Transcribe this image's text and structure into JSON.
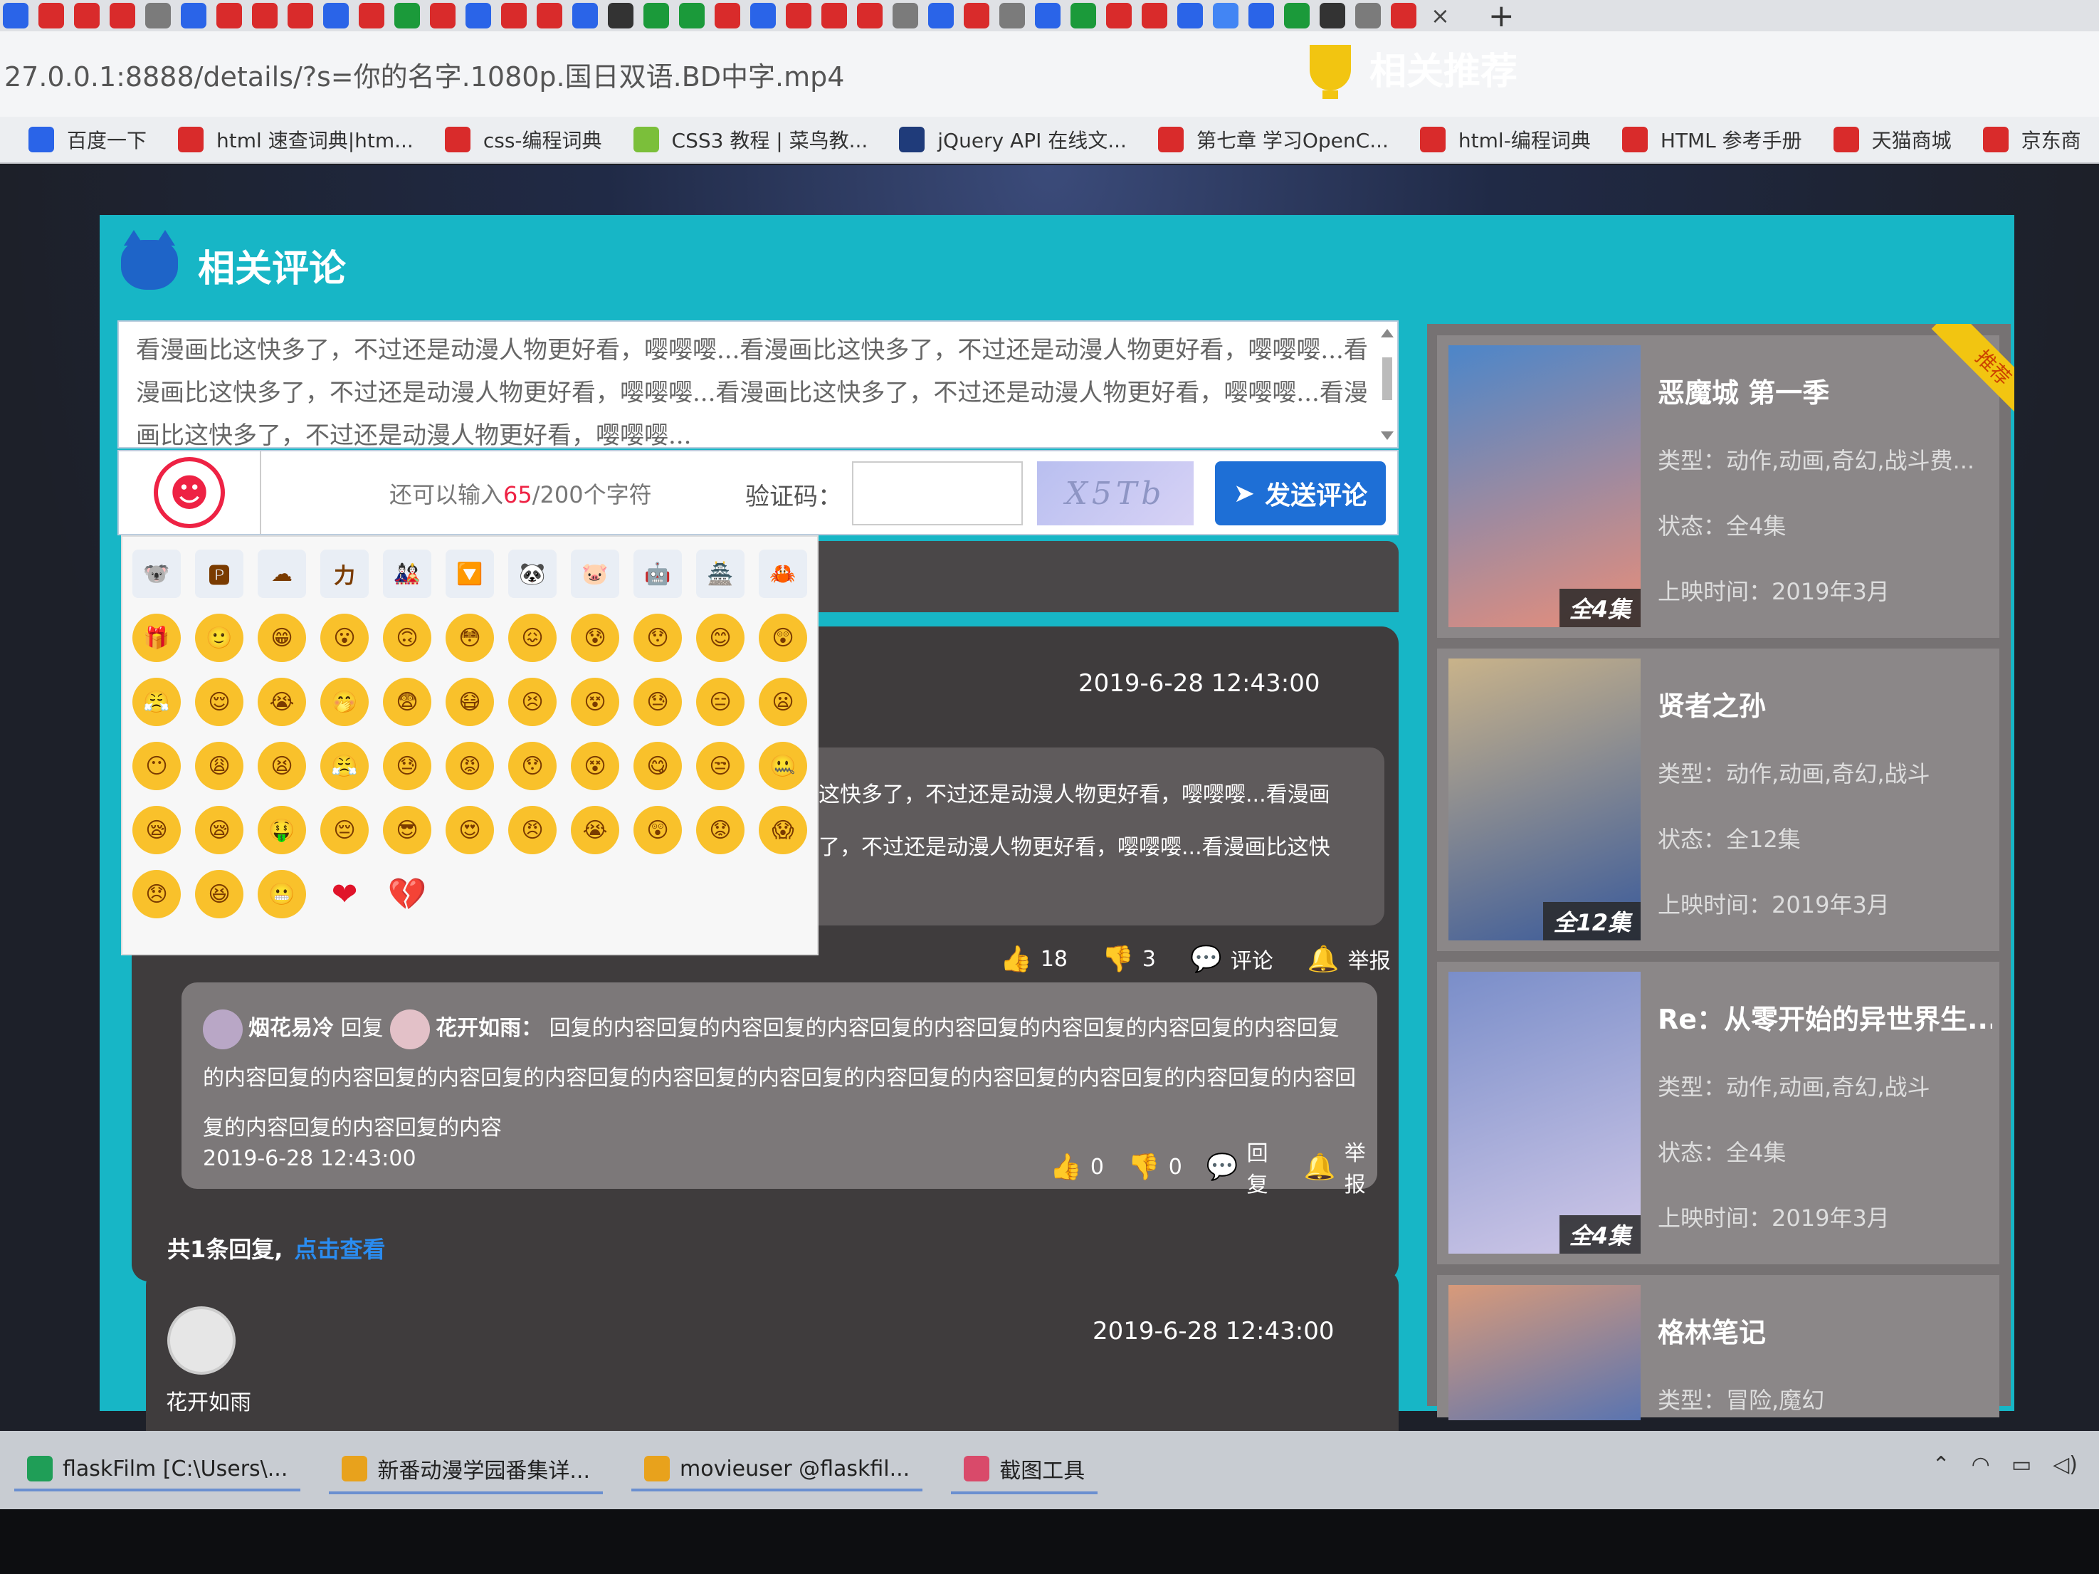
{
  "browser": {
    "tab_icons": [
      {
        "icon": "baidu-paw",
        "color": "#2a64e8"
      },
      {
        "icon": "c-logo",
        "color": "#d92b2b"
      },
      {
        "icon": "c-logo",
        "color": "#d92b2b"
      },
      {
        "icon": "c-logo",
        "color": "#d92b2b"
      },
      {
        "icon": "runoob",
        "color": "#7b7b7b"
      },
      {
        "icon": "baidu-paw",
        "color": "#2a64e8"
      },
      {
        "icon": "c-logo",
        "color": "#d92b2b"
      },
      {
        "icon": "c-logo",
        "color": "#d92b2b"
      },
      {
        "icon": "c-logo",
        "color": "#d92b2b"
      },
      {
        "icon": "baidu-paw",
        "color": "#2a64e8"
      },
      {
        "icon": "c-logo",
        "color": "#d92b2b"
      },
      {
        "icon": "green-c",
        "color": "#1b9a3a"
      },
      {
        "icon": "c-logo",
        "color": "#d92b2b"
      },
      {
        "icon": "baidu-paw",
        "color": "#2a64e8"
      },
      {
        "icon": "c-logo",
        "color": "#d92b2b"
      },
      {
        "icon": "c-logo",
        "color": "#d92b2b"
      },
      {
        "icon": "baidu-paw",
        "color": "#2a64e8"
      },
      {
        "icon": "github",
        "color": "#333333"
      },
      {
        "icon": "green-c",
        "color": "#1b9a3a"
      },
      {
        "icon": "sf",
        "color": "#1b9a3a"
      },
      {
        "icon": "c-logo",
        "color": "#d92b2b"
      },
      {
        "icon": "baidu-paw",
        "color": "#2a64e8"
      },
      {
        "icon": "c-logo",
        "color": "#d92b2b"
      },
      {
        "icon": "c-logo",
        "color": "#d92b2b"
      },
      {
        "icon": "c-logo",
        "color": "#d92b2b"
      },
      {
        "icon": "runoob",
        "color": "#7b7b7b"
      },
      {
        "icon": "baidu-paw",
        "color": "#2a64e8"
      },
      {
        "icon": "c-logo",
        "color": "#d92b2b"
      },
      {
        "icon": "runoob",
        "color": "#7b7b7b"
      },
      {
        "icon": "baidu-paw",
        "color": "#2a64e8"
      },
      {
        "icon": "green-leaf",
        "color": "#1b9a3a"
      },
      {
        "icon": "c-logo",
        "color": "#d92b2b"
      },
      {
        "icon": "c-logo",
        "color": "#d92b2b"
      },
      {
        "icon": "baidu-paw",
        "color": "#2a64e8"
      },
      {
        "icon": "google",
        "color": "#4285f4"
      },
      {
        "icon": "baidu-paw",
        "color": "#2a64e8"
      },
      {
        "icon": "a-logo",
        "color": "#1b9a3a"
      },
      {
        "icon": "github",
        "color": "#333333"
      },
      {
        "icon": "runoob",
        "color": "#7b7b7b"
      },
      {
        "icon": "d-logo",
        "color": "#d92b2b"
      }
    ],
    "tab_close": "×",
    "new_tab": "+",
    "url": "27.0.0.1:8888/details/?s=你的名字.1080p.国日双语.BD中字.mp4"
  },
  "bookmarks": [
    {
      "icon": "baidu-paw-icon",
      "color": "#2a64e8",
      "label": "百度一下"
    },
    {
      "icon": "html-icon",
      "color": "#d92b2b",
      "label": "html 速查词典|htm..."
    },
    {
      "icon": "php-icon",
      "color": "#d92b2b",
      "label": "css-编程词典"
    },
    {
      "icon": "runoob-icon",
      "color": "#7bbf3a",
      "label": "CSS3 教程 | 菜鸟教..."
    },
    {
      "icon": "jquery-icon",
      "color": "#1f3b7a",
      "label": "jQuery API 在线文..."
    },
    {
      "icon": "csdn-icon",
      "color": "#d92b2b",
      "label": "第七章 学习OpenC..."
    },
    {
      "icon": "php-icon",
      "color": "#d92b2b",
      "label": "html-编程词典"
    },
    {
      "icon": "w3-icon",
      "color": "#d92b2b",
      "label": "HTML 参考手册"
    },
    {
      "icon": "tmall-icon",
      "color": "#d92b2b",
      "label": "天猫商城"
    },
    {
      "icon": "jd-icon",
      "color": "#d92b2b",
      "label": "京东商"
    }
  ],
  "comments_section": {
    "title": "相关评论",
    "textarea_text": "看漫画比这快多了，不过还是动漫人物更好看，嘤嘤嘤...看漫画比这快多了，不过还是动漫人物更好看，嘤嘤嘤...看漫画比这快多了，不过还是动漫人物更好看，嘤嘤嘤...看漫画比这快多了，不过还是动漫人物更好看，嘤嘤嘤...看漫画比这快多了，不过还是动漫人物更好看，嘤嘤嘤...",
    "char_prefix": "还可以输入",
    "char_count": "65",
    "char_suffix": "/200个字符",
    "captcha_label": "验证码：",
    "captcha_value": "",
    "captcha_text": "X5Tb",
    "send_label": "发送评论",
    "emoji_button": "emoji-picker-toggle"
  },
  "emoji_picker": {
    "emojis": [
      "🐨",
      "🅿",
      "☁",
      "力",
      "🎎",
      "🔽",
      "🐼",
      "🐷",
      "🤖",
      "🏯",
      "🦀",
      "🎁",
      "🙂",
      "😁",
      "😮",
      "🙃",
      "😳",
      "😖",
      "😰",
      "😯",
      "😊",
      "😲",
      "😤",
      "😌",
      "😭",
      "🤭",
      "😨",
      "😷",
      "😣",
      "😵",
      "😓",
      "😑",
      "😦",
      "😶",
      "😩",
      "😫",
      "😤",
      "😓",
      "😡",
      "😯",
      "😵",
      "😋",
      "😒",
      "🤐",
      "😪",
      "😪",
      "🤑",
      "😔",
      "😎",
      "😍",
      "😠",
      "😭",
      "😲",
      "😟",
      "😱",
      "😞",
      "😆",
      "😬",
      "❤",
      "💔"
    ]
  },
  "comment1": {
    "time": "2019-6-28 12:43:00",
    "text": "这快多了，不过还是动漫人物更好看，嘤嘤嘤...看漫画 了，不过还是动漫人物更好看，嘤嘤嘤...看漫画比这快",
    "likes": "18",
    "dislikes": "3",
    "comment_label": "评论",
    "report_label": "举报"
  },
  "reply": {
    "from": "烟花易冷",
    "reply_word": "回复",
    "to": "花开如雨：",
    "text": "回复的内容回复的内容回复的内容回复的内容回复的内容回复的内容回复的内容回复的内容回复的内容回复的内容回复的内容回复的内容回复的内容回复的内容回复的内容回复的内容回复的内容回复的内容回复的内容回复的内容回复的内容",
    "time": "2019-6-28 12:43:00",
    "likes": "0",
    "dislikes": "0",
    "reply_label": "回复",
    "report_label": "举报"
  },
  "reply_summary": {
    "count_text": "共1条回复,",
    "view_link": "点击查看"
  },
  "comment2": {
    "time": "2019-6-28 12:43:00",
    "user": "花开如雨"
  },
  "recommendations": {
    "title": "相关推荐",
    "ribbon": "推荐",
    "items": [
      {
        "title": "恶魔城 第一季",
        "type": "类型：动作,动画,奇幻,战斗费...",
        "status": "状态：全4集",
        "date": "上映时间：2019年3月",
        "badge": "全4集",
        "colors": [
          "#4c86c9",
          "#e88e7a"
        ]
      },
      {
        "title": "贤者之孙",
        "type": "类型：动作,动画,奇幻,战斗",
        "status": "状态：全12集",
        "date": "上映时间：2019年3月",
        "badge": "全12集",
        "colors": [
          "#c9b38a",
          "#3a5a9a"
        ]
      },
      {
        "title": "Re：从零开始的异世界生...",
        "type": "类型：动作,动画,奇幻,战斗",
        "status": "状态：全4集",
        "date": "上映时间：2019年3月",
        "badge": "全4集",
        "colors": [
          "#7a8ec9",
          "#d0c8e8"
        ]
      },
      {
        "title": "格林笔记",
        "type": "类型：冒险,魔幻",
        "status": "",
        "date": "",
        "badge": "",
        "colors": [
          "#d89a7a",
          "#5a74b0"
        ]
      }
    ]
  },
  "taskbar": {
    "items": [
      {
        "icon": "pycharm-icon",
        "color": "#1f9e57",
        "label": "flaskFilm [C:\\Users\\..."
      },
      {
        "icon": "chrome-icon",
        "color": "#e8a21c",
        "label": "新番动漫学园番集详..."
      },
      {
        "icon": "chrome-icon",
        "color": "#e8a21c",
        "label": "movieuser @flaskfil..."
      },
      {
        "icon": "snipping-tool-icon",
        "color": "#d94a6a",
        "label": "截图工具"
      }
    ],
    "tray": [
      "^",
      "wifi",
      "battery",
      "volume"
    ]
  }
}
